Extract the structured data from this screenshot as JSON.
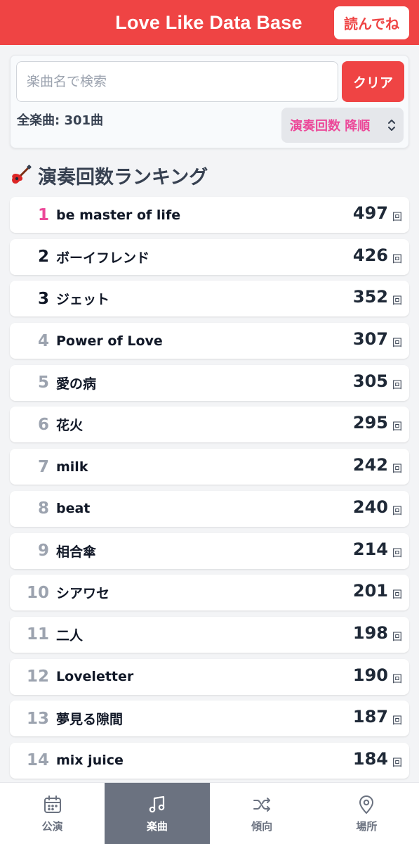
{
  "header": {
    "title": "Love Like Data Base",
    "readme_label": "読んでね"
  },
  "search": {
    "placeholder": "楽曲名で検索",
    "clear_label": "クリア",
    "total": "全楽曲: 301曲",
    "sort_value": "演奏回数 降順"
  },
  "section": {
    "icon": "guitar-icon",
    "title": "演奏回数ランキング"
  },
  "ranking": [
    {
      "rank": "1",
      "title": "be master of life",
      "count": "497",
      "unit": "回"
    },
    {
      "rank": "2",
      "title": "ボーイフレンド",
      "count": "426",
      "unit": "回"
    },
    {
      "rank": "3",
      "title": "ジェット",
      "count": "352",
      "unit": "回"
    },
    {
      "rank": "4",
      "title": "Power of Love",
      "count": "307",
      "unit": "回"
    },
    {
      "rank": "5",
      "title": "愛の病",
      "count": "305",
      "unit": "回"
    },
    {
      "rank": "6",
      "title": "花火",
      "count": "295",
      "unit": "回"
    },
    {
      "rank": "7",
      "title": "milk",
      "count": "242",
      "unit": "回"
    },
    {
      "rank": "8",
      "title": "beat",
      "count": "240",
      "unit": "回"
    },
    {
      "rank": "9",
      "title": "相合傘",
      "count": "214",
      "unit": "回"
    },
    {
      "rank": "10",
      "title": "シアワセ",
      "count": "201",
      "unit": "回"
    },
    {
      "rank": "11",
      "title": "二人",
      "count": "198",
      "unit": "回"
    },
    {
      "rank": "12",
      "title": "Loveletter",
      "count": "190",
      "unit": "回"
    },
    {
      "rank": "13",
      "title": "夢見る隙間",
      "count": "187",
      "unit": "回"
    },
    {
      "rank": "14",
      "title": "mix juice",
      "count": "184",
      "unit": "回"
    }
  ],
  "nav": [
    {
      "label": "公演",
      "icon": "calendar-icon",
      "active": false
    },
    {
      "label": "楽曲",
      "icon": "music-note-icon",
      "active": true
    },
    {
      "label": "傾向",
      "icon": "shuffle-icon",
      "active": false
    },
    {
      "label": "場所",
      "icon": "map-pin-icon",
      "active": false
    }
  ],
  "colors": {
    "brand": "#ef4444",
    "rank_first": "#ec4899",
    "sort_text": "#ec4899",
    "nav_active": "#6b7280"
  }
}
